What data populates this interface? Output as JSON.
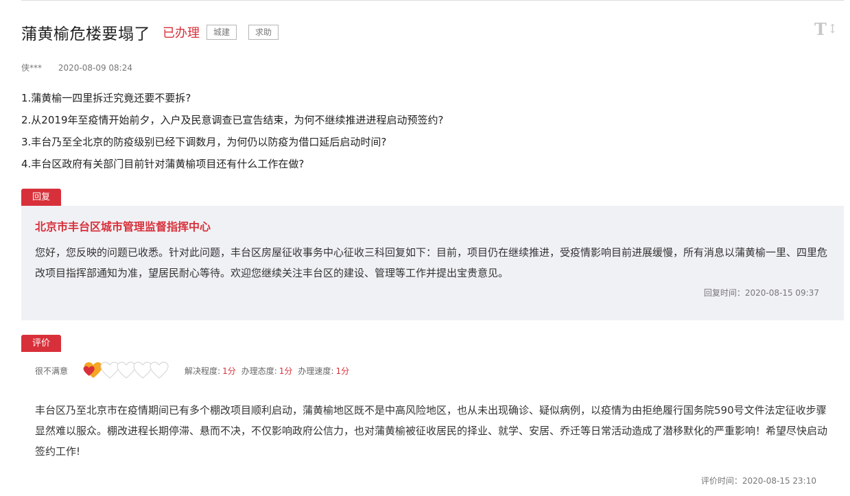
{
  "header": {
    "title": "蒲黄榆危楼要塌了",
    "status": "已办理",
    "tags": [
      "城建",
      "求助"
    ],
    "font_toggle_icon": "font-size-toggle-icon"
  },
  "meta": {
    "author": "侠***",
    "date": "2020-08-09 08:24"
  },
  "questions": [
    "1.蒲黄榆一四里拆迁究竟还要不要拆?",
    "2.从2019年至疫情开始前夕，入户及民意调查已宣告结束，为何不继续推进进程启动预签约?",
    "3.丰台乃至全北京的防疫级别已经下调数月，为何仍以防疫为借口延后启动时间?",
    "4.丰台区政府有关部门目前针对蒲黄榆项目还有什么工作在做?"
  ],
  "reply": {
    "label": "回复",
    "org": "北京市丰台区城市管理监督指挥中心",
    "text": "您好，您反映的问题已收悉。针对此问题，丰台区房屋征收事务中心征收三科回复如下：目前，项目仍在继续推进，受疫情影响目前进展缓慢，所有消息以蒲黄榆一里、四里危改项目指挥部通知为准，望居民耐心等待。欢迎您继续关注丰台区的建设、管理等工作并提出宝贵意见。",
    "time": "回复时间：2020-08-15 09:37"
  },
  "evaluation": {
    "label": "评价",
    "level": "很不满意",
    "hearts_filled": 1,
    "hearts_total": 5,
    "scores": [
      {
        "label": "解决程度:",
        "value": "1分"
      },
      {
        "label": "办理态度:",
        "value": "1分"
      },
      {
        "label": "办理速度:",
        "value": "1分"
      }
    ],
    "text": "丰台区乃至北京市在疫情期间已有多个棚改项目顺利启动，蒲黄榆地区既不是中高风险地区，也从未出现确诊、疑似病例，以疫情为由拒绝履行国务院590号文件法定征收步骤显然难以服众。棚改进程长期停滞、悬而不决，不仅影响政府公信力，也对蒲黄榆被征收居民的择业、就学、安居、乔迁等日常活动造成了潜移默化的严重影响！希望尽快启动签约工作!",
    "time": "评价时间：2020-08-15 23:10"
  },
  "colors": {
    "accent": "#d8303a",
    "reply_bg": "#f0f1f5",
    "heart_orange": "#f5a623"
  }
}
